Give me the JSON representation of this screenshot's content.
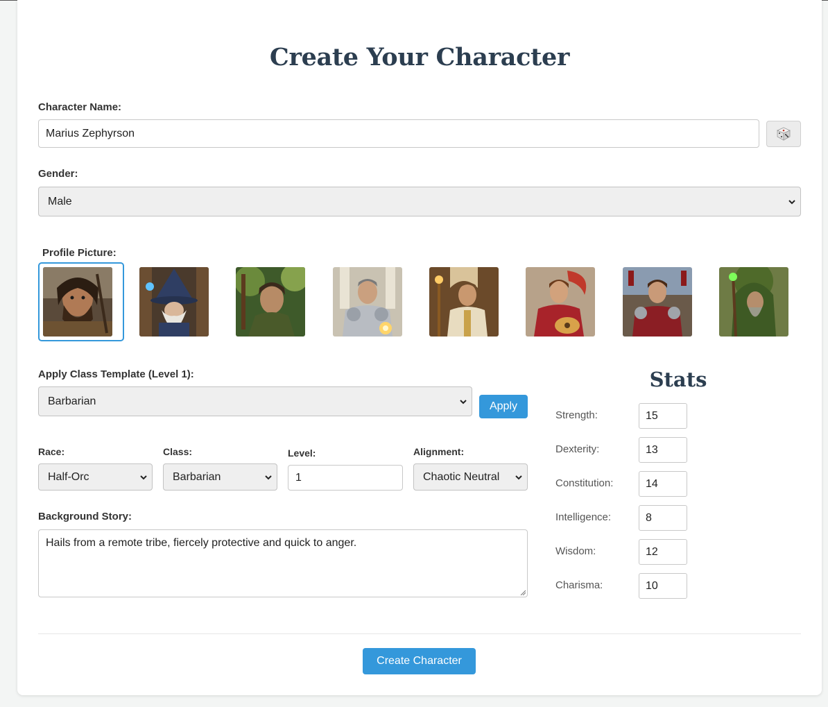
{
  "page_title": "Create Your Character",
  "name": {
    "label": "Character Name:",
    "value": "Marius Zephyrson"
  },
  "gender": {
    "label": "Gender:",
    "value": "Male"
  },
  "profile": {
    "label": "Profile Picture:",
    "portraits": [
      "barbarian-portrait",
      "wizard-portrait",
      "ranger-portrait",
      "paladin-portrait",
      "cleric-portrait",
      "bard-portrait",
      "fighter-portrait",
      "druid-portrait"
    ],
    "selected_index": 0
  },
  "template": {
    "label": "Apply Class Template (Level 1):",
    "value": "Barbarian",
    "apply_label": "Apply"
  },
  "race": {
    "label": "Race:",
    "value": "Half-Orc"
  },
  "class": {
    "label": "Class:",
    "value": "Barbarian"
  },
  "level": {
    "label": "Level:",
    "value": "1"
  },
  "alignment": {
    "label": "Alignment:",
    "value": "Chaotic Neutral"
  },
  "background": {
    "label": "Background Story:",
    "value": "Hails from a remote tribe, fiercely protective and quick to anger."
  },
  "stats": {
    "title": "Stats",
    "items": [
      {
        "label": "Strength:",
        "value": "15"
      },
      {
        "label": "Dexterity:",
        "value": "13"
      },
      {
        "label": "Constitution:",
        "value": "14"
      },
      {
        "label": "Intelligence:",
        "value": "8"
      },
      {
        "label": "Wisdom:",
        "value": "12"
      },
      {
        "label": "Charisma:",
        "value": "10"
      }
    ]
  },
  "create_label": "Create Character",
  "colors": {
    "accent": "#3498db",
    "heading": "#2c3e50"
  }
}
